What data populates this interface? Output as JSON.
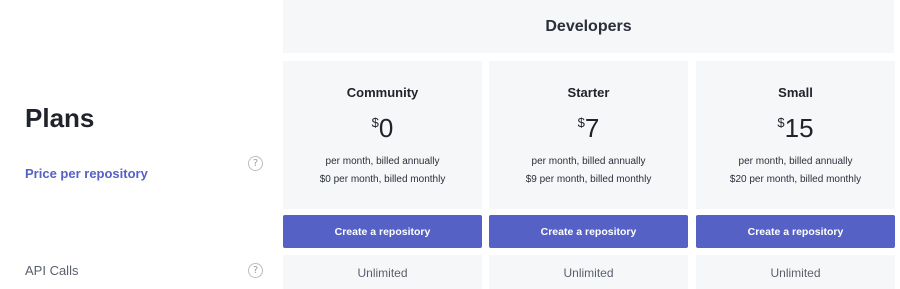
{
  "group_header": "Developers",
  "plans_title": "Plans",
  "rows": {
    "price_label": "Price per repository",
    "api_label": "API Calls",
    "help_glyph": "?"
  },
  "plans": [
    {
      "name": "Community",
      "currency": "$",
      "amount": "0",
      "note_annual": "per month, billed annually",
      "note_monthly": "$0 per month, billed monthly",
      "cta": "Create a repository",
      "api_calls": "Unlimited"
    },
    {
      "name": "Starter",
      "currency": "$",
      "amount": "7",
      "note_annual": "per month, billed annually",
      "note_monthly": "$9 per month, billed monthly",
      "cta": "Create a repository",
      "api_calls": "Unlimited"
    },
    {
      "name": "Small",
      "currency": "$",
      "amount": "15",
      "note_annual": "per month, billed annually",
      "note_monthly": "$20 per month, billed monthly",
      "cta": "Create a repository",
      "api_calls": "Unlimited"
    }
  ],
  "colors": {
    "accent": "#5561c4",
    "card_bg": "#f6f7f9"
  }
}
